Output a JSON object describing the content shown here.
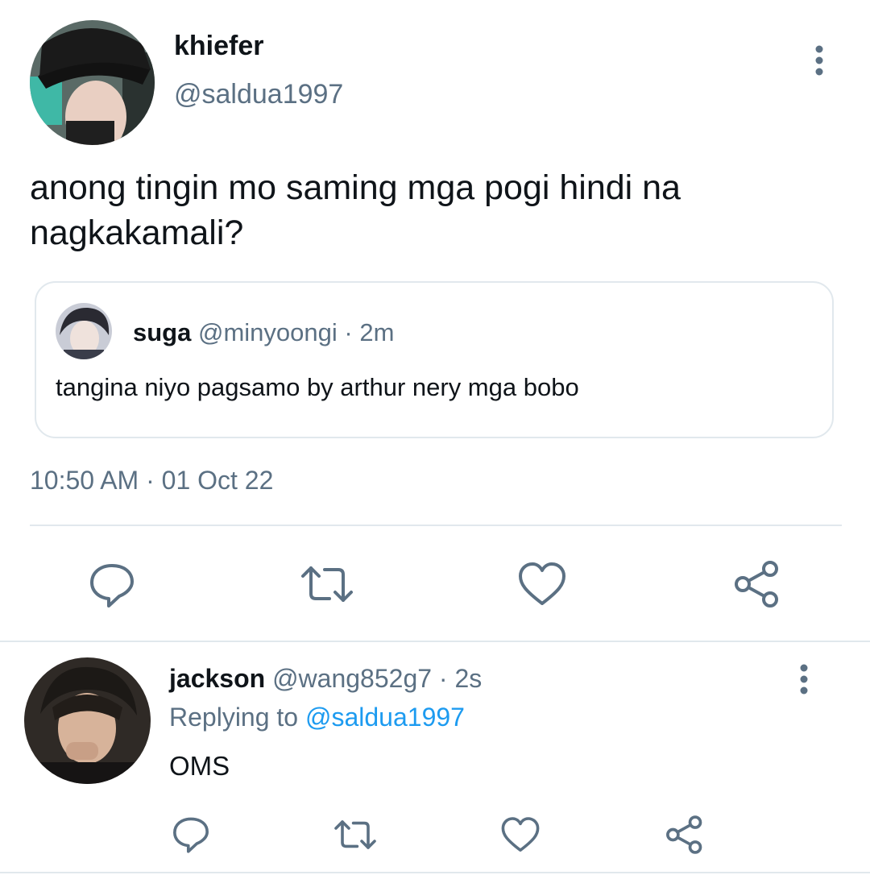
{
  "main_tweet": {
    "display_name": "khiefer",
    "handle": "@saldua1997",
    "text": "anong tingin mo saming mga pogi hindi na nagkakamali?",
    "timestamp": "10:50 AM · 01 Oct 22",
    "more_icon": "more-vertical-icon"
  },
  "quoted_tweet": {
    "display_name": "suga",
    "handle": "@minyoongi",
    "time_ago": "· 2m",
    "text": "tangina niyo pagsamo by arthur nery mga bobo"
  },
  "action_icons": [
    "reply-icon",
    "retweet-icon",
    "like-icon",
    "share-icon"
  ],
  "reply": {
    "display_name": "jackson",
    "handle": "@wang852g7",
    "time_ago": "· 2s",
    "replying_prefix": "Replying to",
    "replying_to": "@saldua1997",
    "text": "OMS"
  },
  "colors": {
    "text": "#0f1419",
    "muted": "#5b7083",
    "link": "#1d9bf0",
    "divider": "#e1e8ed"
  }
}
